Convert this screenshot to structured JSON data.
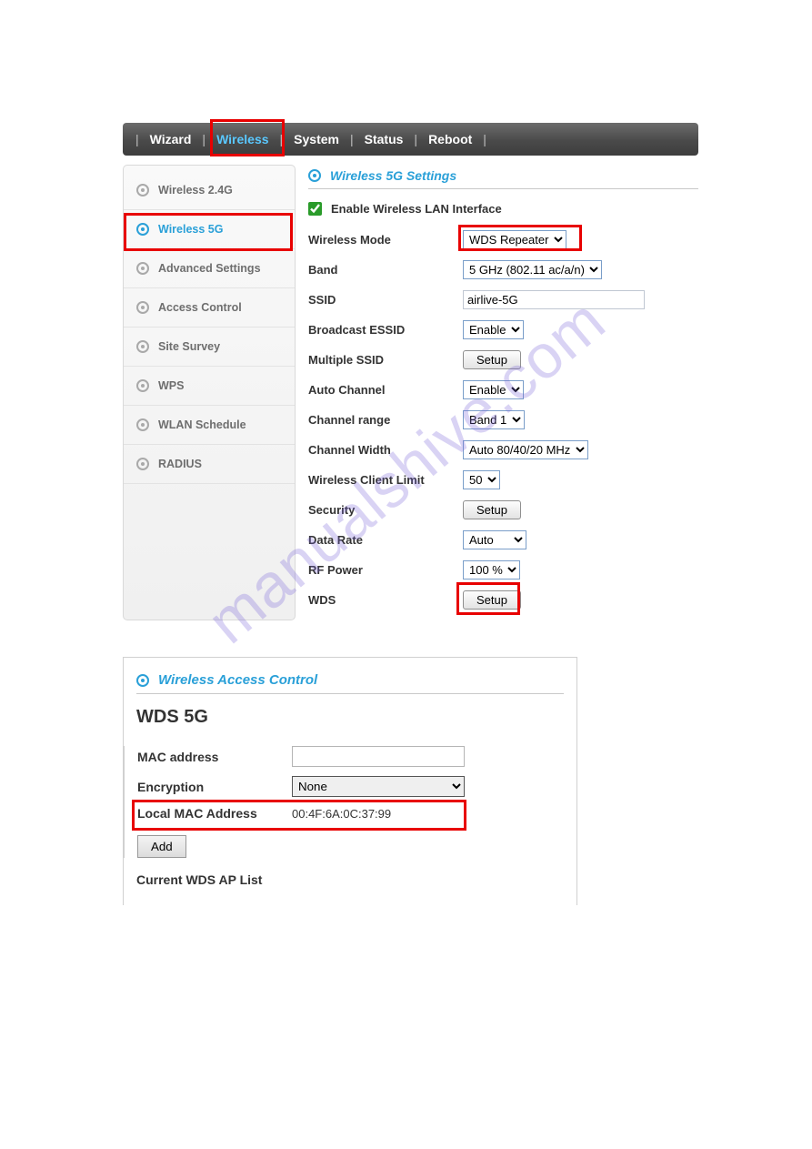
{
  "nav": {
    "items": [
      "Wizard",
      "Wireless",
      "System",
      "Status",
      "Reboot"
    ],
    "active": "Wireless"
  },
  "sidebar": {
    "items": [
      {
        "label": "Wireless 2.4G"
      },
      {
        "label": "Wireless 5G",
        "active": true
      },
      {
        "label": "Advanced Settings"
      },
      {
        "label": "Access Control"
      },
      {
        "label": "Site Survey"
      },
      {
        "label": "WPS"
      },
      {
        "label": "WLAN Schedule"
      },
      {
        "label": "RADIUS"
      }
    ]
  },
  "panel": {
    "title": "Wireless 5G Settings",
    "enable_label": "Enable Wireless LAN Interface",
    "enable_checked": true,
    "rows": {
      "mode": {
        "label": "Wireless Mode",
        "value": "WDS Repeater"
      },
      "band": {
        "label": "Band",
        "value": "5 GHz (802.11 ac/a/n)"
      },
      "ssid": {
        "label": "SSID",
        "value": "airlive-5G"
      },
      "bcast": {
        "label": "Broadcast ESSID",
        "value": "Enable"
      },
      "mssid": {
        "label": "Multiple SSID",
        "btn": "Setup"
      },
      "autoch": {
        "label": "Auto Channel",
        "value": "Enable"
      },
      "chrange": {
        "label": "Channel range",
        "value": "Band 1"
      },
      "chwidth": {
        "label": "Channel Width",
        "value": "Auto 80/40/20 MHz"
      },
      "climit": {
        "label": "Wireless Client Limit",
        "value": "50"
      },
      "security": {
        "label": "Security",
        "btn": "Setup"
      },
      "datarate": {
        "label": "Data Rate",
        "value": "Auto"
      },
      "rfpower": {
        "label": "RF Power",
        "value": "100 %"
      },
      "wds": {
        "label": "WDS",
        "btn": "Setup"
      }
    }
  },
  "wds_panel": {
    "title": "Wireless Access Control",
    "heading": "WDS 5G",
    "mac_label": "MAC address",
    "mac_value": "",
    "enc_label": "Encryption",
    "enc_value": "None",
    "local_label": "Local MAC Address",
    "local_value": "00:4F:6A:0C:37:99",
    "add_btn": "Add",
    "list_label": "Current WDS AP List"
  },
  "watermark": "manualshive.com"
}
